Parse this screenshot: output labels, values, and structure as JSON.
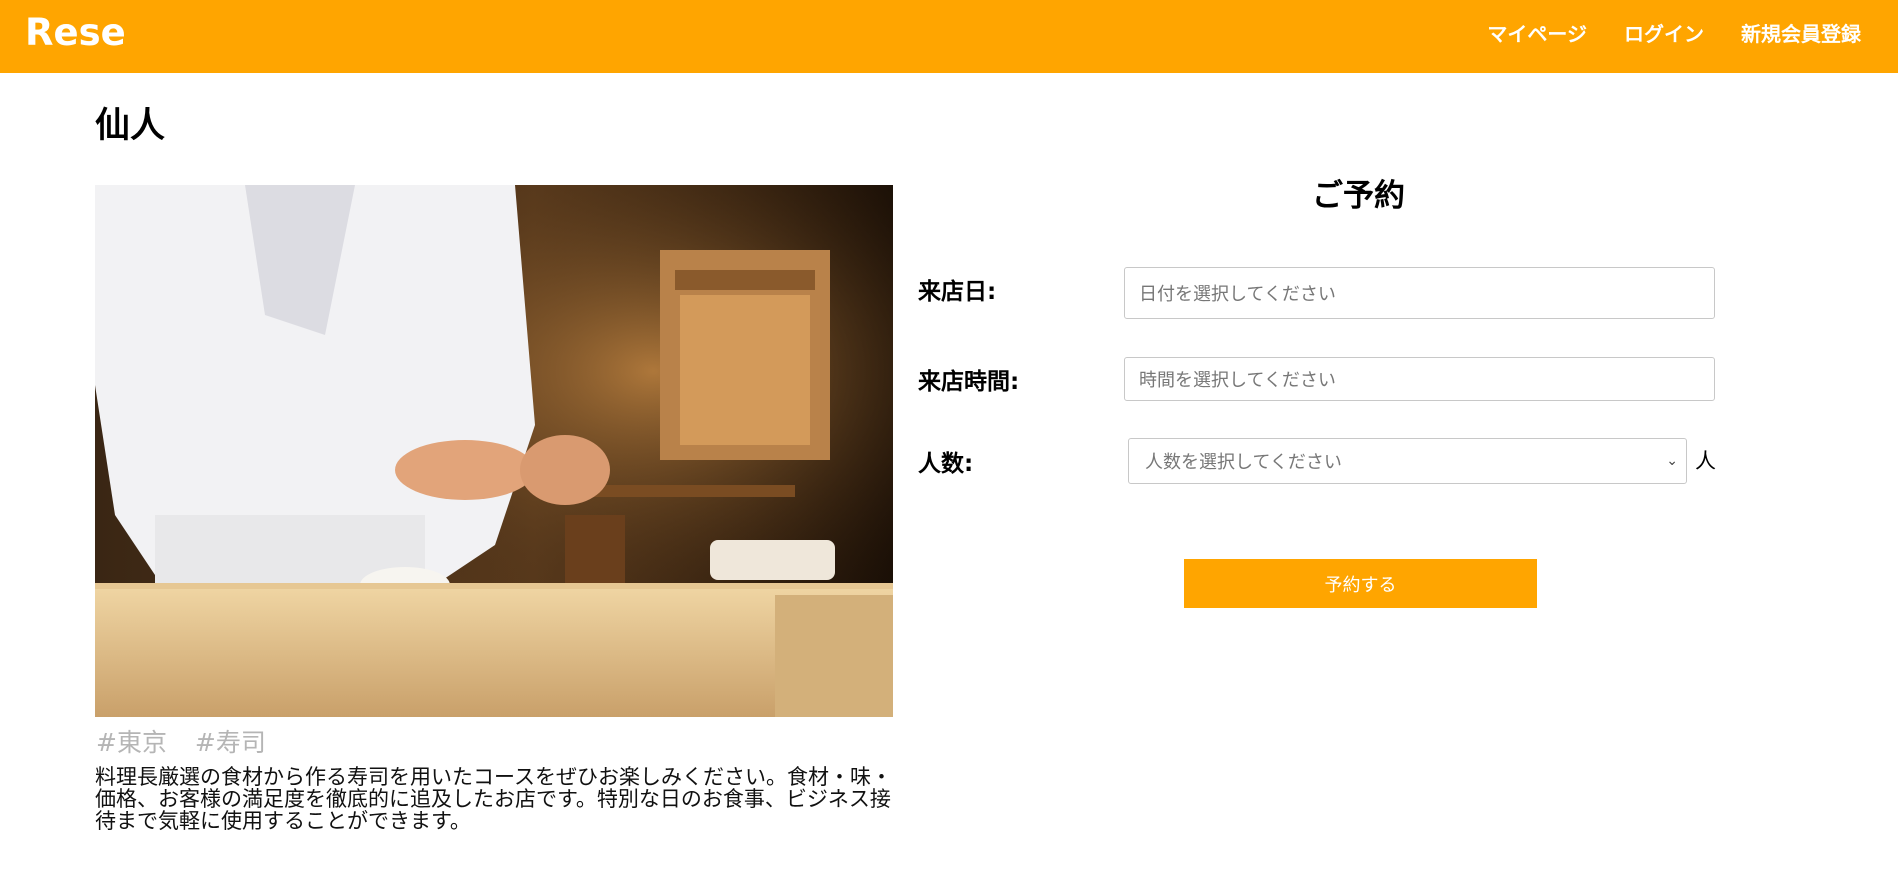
{
  "header": {
    "logo": "Rese",
    "nav": {
      "mypage": "マイページ",
      "login": "ログイン",
      "register": "新規会員登録"
    }
  },
  "shop": {
    "name": "仙人",
    "tags": [
      "#東京",
      "#寿司"
    ],
    "description": "料理長厳選の食材から作る寿司を用いたコースをぜひお楽しみください。食材・味・価格、お客様の満足度を徹底的に追及したお店です。特別な日のお食事、ビジネス接待まで気軽に使用することができます。"
  },
  "reservation": {
    "title": "ご予約",
    "date_label": "来店日:",
    "date_placeholder": "日付を選択してください",
    "time_label": "来店時間:",
    "time_placeholder": "時間を選択してください",
    "people_label": "人数:",
    "people_placeholder": "人数を選択してください",
    "people_unit": "人",
    "submit_label": "予約する"
  },
  "colors": {
    "accent": "#ffa500",
    "tag": "#b5b5b5"
  }
}
